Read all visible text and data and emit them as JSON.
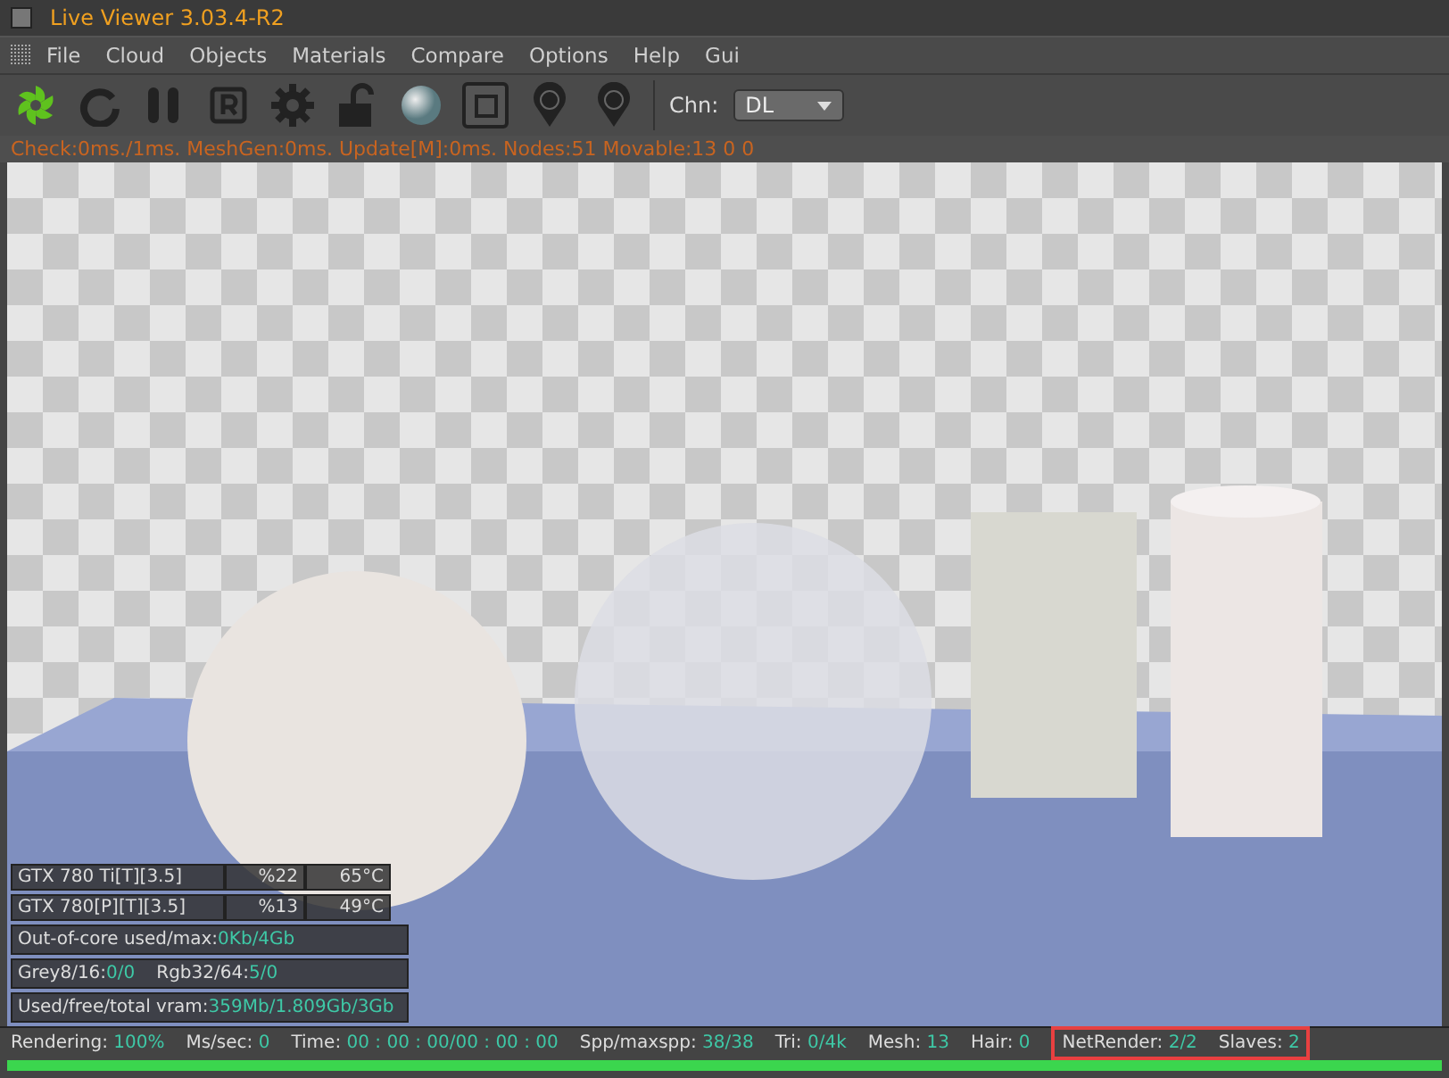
{
  "window": {
    "title": "Live Viewer 3.03.4-R2"
  },
  "menu": [
    "File",
    "Cloud",
    "Objects",
    "Materials",
    "Compare",
    "Options",
    "Help",
    "Gui"
  ],
  "toolbar": {
    "channel_label": "Chn:",
    "channel_value": "DL"
  },
  "info_line": "Check:0ms./1ms. MeshGen:0ms. Update[M]:0ms. Nodes:51 Movable:13  0 0",
  "gpus": [
    {
      "name": "GTX 780 Ti[T][3.5]",
      "load": "%22",
      "temp": "65°C"
    },
    {
      "name": "GTX 780[P][T][3.5]",
      "load": "%13",
      "temp": "49°C"
    }
  ],
  "stats": [
    {
      "items": [
        {
          "label": "Out-of-core used/max:",
          "value": "0Kb/4Gb"
        }
      ]
    },
    {
      "items": [
        {
          "label": "Grey8/16:",
          "value": "0/0"
        },
        {
          "label": "Rgb32/64:",
          "value": "5/0"
        }
      ]
    },
    {
      "items": [
        {
          "label": "Used/free/total vram:",
          "value": "359Mb/1.809Gb/3Gb"
        }
      ]
    }
  ],
  "status_bar": [
    {
      "label": "Rendering:",
      "value": "100%",
      "highlighted": false
    },
    {
      "label": "Ms/sec:",
      "value": "0",
      "highlighted": false
    },
    {
      "label": "Time:",
      "value": "00 : 00 : 00/00 : 00 : 00",
      "highlighted": false
    },
    {
      "label": "Spp/maxspp:",
      "value": "38/38",
      "highlighted": false
    },
    {
      "label": "Tri:",
      "value": "0/4k",
      "highlighted": false
    },
    {
      "label": "Mesh:",
      "value": "13",
      "highlighted": false
    },
    {
      "label": "Hair:",
      "value": "0",
      "highlighted": false
    },
    {
      "label": "NetRender:",
      "value": "2/2",
      "highlighted": true
    },
    {
      "label": "Slaves:",
      "value": "2",
      "highlighted": true
    }
  ],
  "progress": {
    "level": 1.0
  }
}
